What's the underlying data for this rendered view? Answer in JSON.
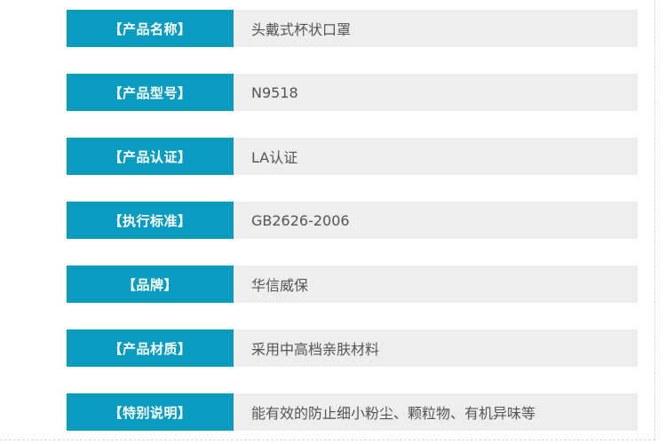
{
  "specs": [
    {
      "label": "【产品名称】",
      "value": "头戴式杯状口罩"
    },
    {
      "label": "【产品型号】",
      "value": "N9518"
    },
    {
      "label": "【产品认证】",
      "value": "LA认证"
    },
    {
      "label": "【执行标准】",
      "value": "GB2626-2006"
    },
    {
      "label": "【品牌】",
      "value": "华信威保"
    },
    {
      "label": "【产品材质】",
      "value": "采用中高档亲肤材料"
    },
    {
      "label": "【特别说明】",
      "value": "能有效的防止细小粉尘、颗粒物、有机异味等"
    }
  ],
  "colors": {
    "label_bg": "#0a9cc0",
    "value_bg": "#eeeeee"
  }
}
